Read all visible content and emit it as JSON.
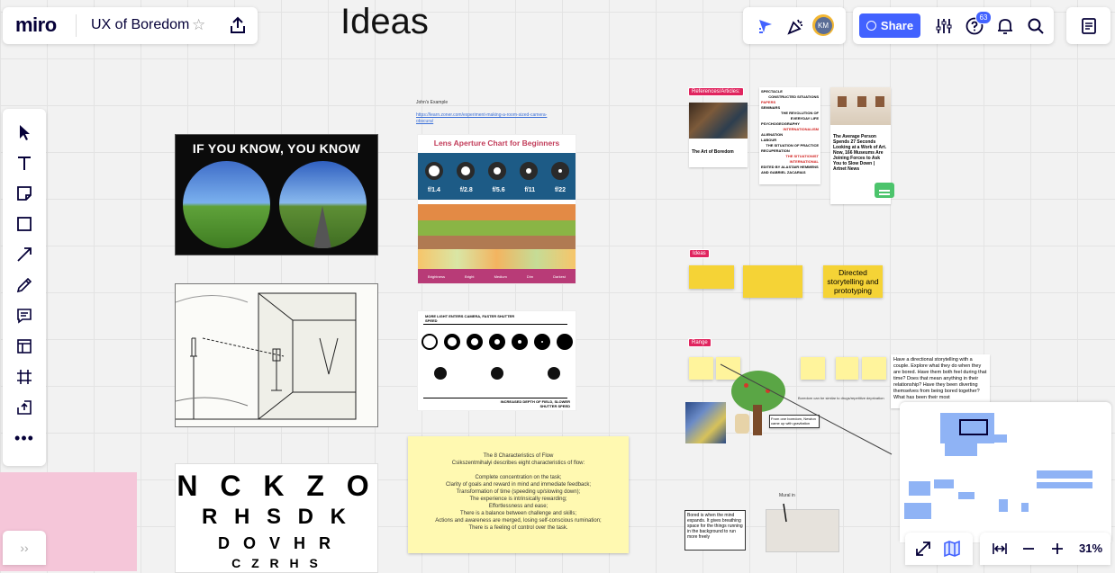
{
  "topbar": {
    "logo": "miro",
    "board_name": "UX of Boredom",
    "share_label": "Share",
    "avatar_initials": "KM",
    "help_badge": "63"
  },
  "board": {
    "frame_title": "Ideas",
    "johns_example": {
      "label": "John's Example",
      "link": "https://learn.zoner.com/experiment-making-a-room-sized-camera-obscura/"
    },
    "iyk_image_text": "IF YOU KNOW, YOU KNOW",
    "lens_chart": {
      "title": "Lens Aperture Chart for Beginners",
      "stops": [
        "f/1.4",
        "f/2.8",
        "f/5.6",
        "f/11",
        "f/22"
      ],
      "row_labels": [
        "Brightness",
        "Bright",
        "Medium",
        "Dim",
        "Darkest"
      ]
    },
    "shutter_diagram": {
      "top_label": "MORE LIGHT ENTERS CAMERA, FASTER SHUTTER SPEED",
      "bottom_label": "INCREASED DEPTH OF FIELD, SLOWER SHUTTER SPEED"
    },
    "eye_chart_rows": [
      "N C K Z O",
      "R H S D K",
      "D O V H R",
      "C Z R H S"
    ],
    "flow_sticky": {
      "title": "The 8 Characteristics of Flow",
      "subtitle": "Csikszentmihalyi describes eight characteristics of flow:",
      "items": [
        "Complete concentration on the task;",
        "Clarity of goals and reward in mind and immediate feedback;",
        "Transformation of time (speeding up/slowing down);",
        "The experience is intrinsically rewarding;",
        "Effortlessness and ease;",
        "There is a balance between challenge and skills;",
        "Actions and awareness are merged, losing self-conscious rumination;",
        "There is a feeling of control over the task."
      ]
    },
    "references": {
      "tag": "References/Articles:",
      "art_card_title": "The Art of Boredom",
      "artnet_card_title": "The Average Person Spends 27 Seconds Looking at a Work of Art. Now, 166 Museums Are Joining Forces to Ask You to Slow Down | Artnet News",
      "wordcloud": [
        "SPECTACLE",
        "CONSTRUCTED SITUATIONS",
        "PAPERS",
        "SEMINARS",
        "THE REVOLUTION OF EVERYDAY LIFE",
        "PSYCHOGEOGRAPHY",
        "INTERNATIONALISM",
        "ALIENATION",
        "LABOUR",
        "THE SITUATION OF PRACTICE",
        "RECUPERATION",
        "THE SITUATIONIST INTERNATIONAL",
        "EDITED BY ALASTAIR HEMMENS AND GABRIEL ZACARIAS"
      ]
    },
    "ideas_tag": "Ideas",
    "idea_stickies": [
      "Directed storytelling and prototyping"
    ],
    "range_tag": "Range",
    "couple_note": "Have a directional storytelling with a couple. Explore what they do when they are bored. Have them both feel during that time? Does that mean anything in their relationship? Have they been diverting themselves from being bored together? What has been their most",
    "boredom_similar": "Boredom can be similar to drugs/repetitive deprivation",
    "bored_box": "Bored is when the mind expands. It gives breathing space for the things running in the background to run more freely",
    "mural_label": "Mural in",
    "tree_note": "From one boredom, Newton came up with gravitation"
  },
  "left_toolbar": {
    "tools": [
      "select-tool",
      "text-tool",
      "sticky-note-tool",
      "shape-tool",
      "connection-line-tool",
      "pen-tool",
      "comment-tool",
      "template-tool",
      "frame-tool",
      "upload-tool",
      "more-tools"
    ]
  },
  "bottom_controls": {
    "zoom_level": "31%"
  },
  "colors": {
    "accent": "#4262ff",
    "sticky_yellow": "#f5d336",
    "sticky_pale": "#fff9b1",
    "tag_red": "#e0245e",
    "minimap_blue": "#8fb3f5",
    "pink": "#f5c6d9"
  }
}
